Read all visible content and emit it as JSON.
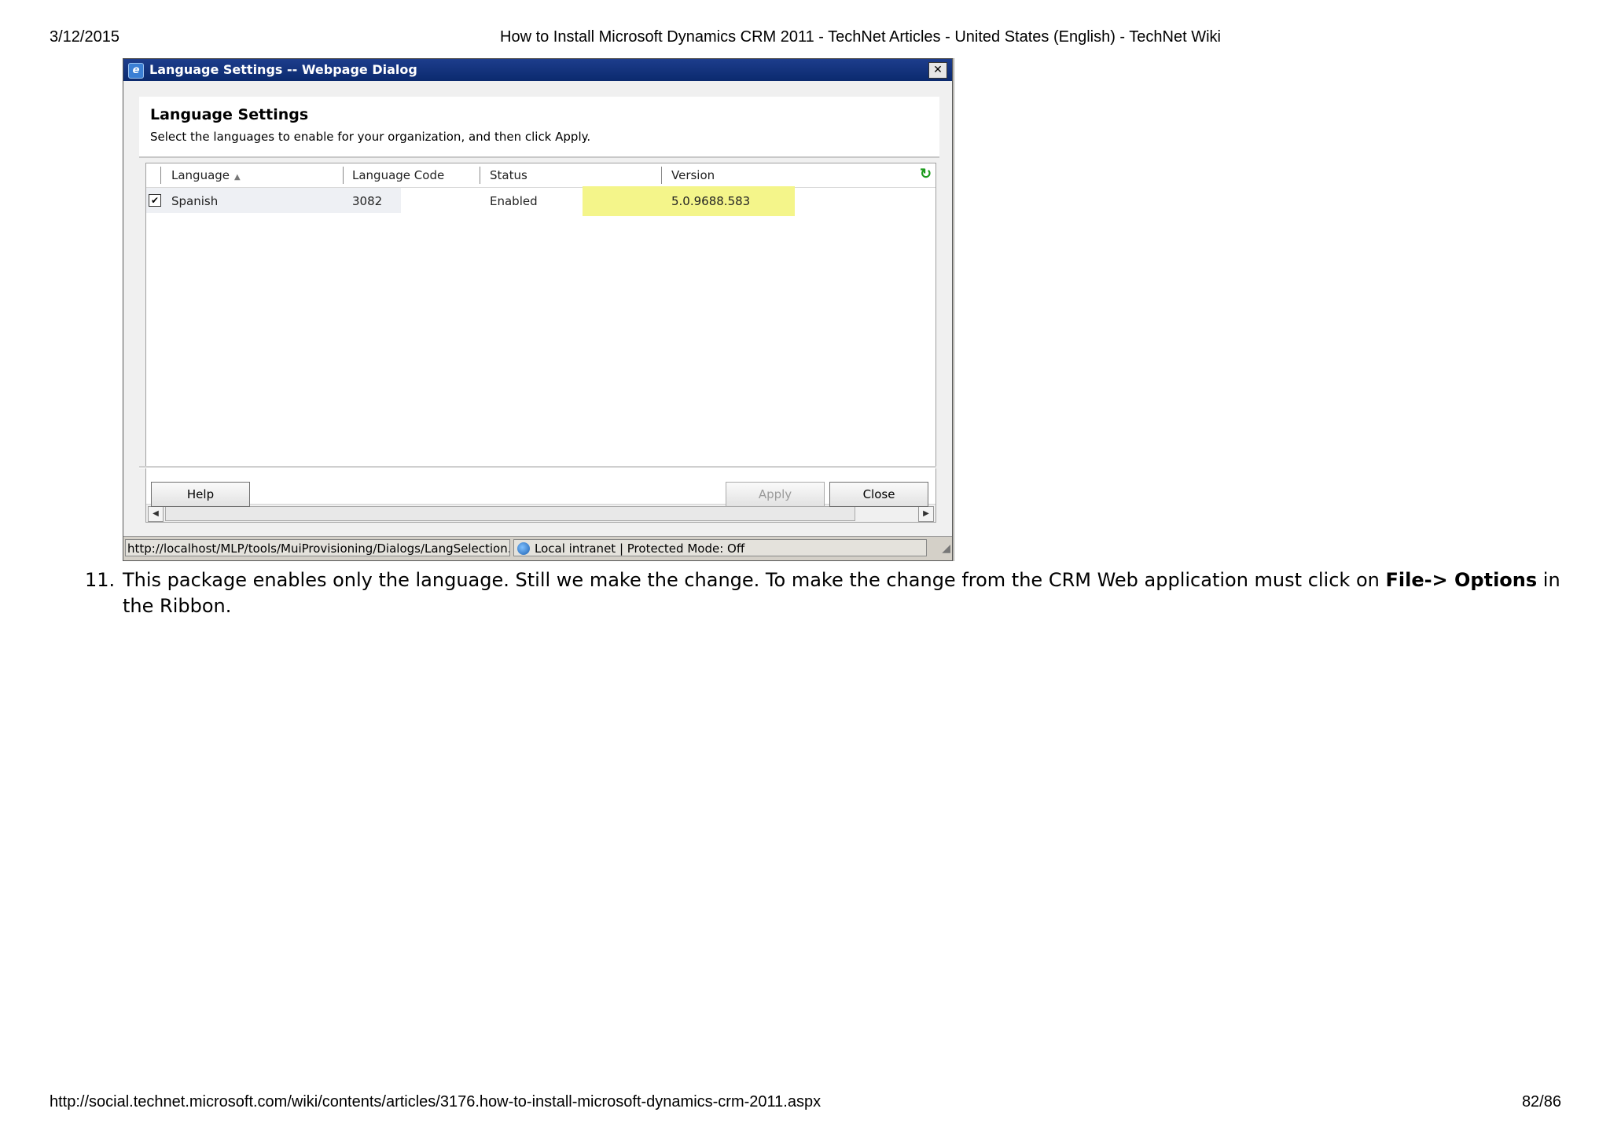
{
  "page": {
    "date": "3/12/2015",
    "title": "How to Install Microsoft Dynamics CRM 2011 - TechNet Articles - United States (English) - TechNet Wiki",
    "url": "http://social.technet.microsoft.com/wiki/contents/articles/3176.how-to-install-microsoft-dynamics-crm-2011.aspx",
    "page_number": "82/86"
  },
  "dialog": {
    "window_title": "Language Settings -- Webpage Dialog",
    "close_glyph": "✕",
    "heading": "Language Settings",
    "description": "Select the languages to enable for your organization, and then click Apply.",
    "columns": {
      "language": "Language",
      "language_code": "Language Code",
      "status": "Status",
      "version": "Version"
    },
    "rows": [
      {
        "checked": true,
        "language": "Spanish",
        "language_code": "3082",
        "status": "Enabled",
        "version": "5.0.9688.583"
      }
    ],
    "buttons": {
      "help": "Help",
      "apply": "Apply",
      "close": "Close"
    },
    "statusbar": {
      "url": "http://localhost/MLP/tools/MuiProvisioning/Dialogs/LangSelection.as",
      "zone": "Local intranet | Protected Mode: Off"
    },
    "highlight_color": "#f4f58a"
  },
  "step": {
    "number": "11.",
    "text_before": "This package enables only the language. Still we make the change. To make the change from the CRM Web application must click on ",
    "bold": "File-> Options",
    "text_after": " in the Ribbon."
  }
}
